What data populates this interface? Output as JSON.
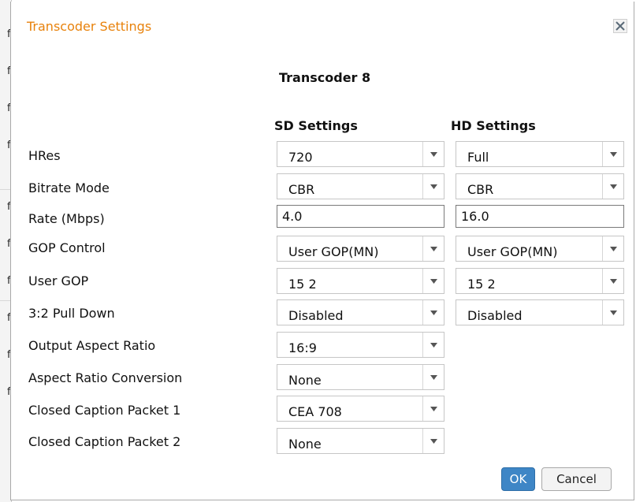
{
  "background_page": {
    "glyphs": [
      "f",
      "f",
      "f",
      "f",
      "f",
      "f",
      "f",
      "f",
      "f",
      "f"
    ]
  },
  "dialog": {
    "title": "Transcoder Settings",
    "close_icon": "close-icon",
    "subtitle": "Transcoder 8",
    "columns": {
      "sd": "SD Settings",
      "hd": "HD Settings"
    },
    "rows": [
      {
        "label": "HRes",
        "type": "select",
        "sd": "720",
        "hd": "Full"
      },
      {
        "label": "Bitrate Mode",
        "type": "select",
        "sd": "CBR",
        "hd": "CBR"
      },
      {
        "label": "Rate (Mbps)",
        "type": "text",
        "sd": "4.0",
        "hd": "16.0"
      },
      {
        "label": "GOP Control",
        "type": "select",
        "sd": "User GOP(MN)",
        "hd": "User GOP(MN)"
      },
      {
        "label": "User GOP",
        "type": "select",
        "sd": "15 2",
        "hd": "15 2"
      },
      {
        "label": "3:2 Pull Down",
        "type": "select",
        "sd": "Disabled",
        "hd": "Disabled"
      },
      {
        "label": "Output Aspect Ratio",
        "type": "select",
        "sd": "16:9"
      },
      {
        "label": "Aspect Ratio Conversion",
        "type": "select",
        "sd": "None"
      },
      {
        "label": "Closed Caption Packet 1",
        "type": "select",
        "sd": "CEA 708"
      },
      {
        "label": "Closed Caption Packet 2",
        "type": "select",
        "sd": "None"
      }
    ],
    "buttons": {
      "ok": "OK",
      "cancel": "Cancel"
    },
    "colors": {
      "title": "#e8820c",
      "ok_button": "#3e86c6"
    }
  }
}
